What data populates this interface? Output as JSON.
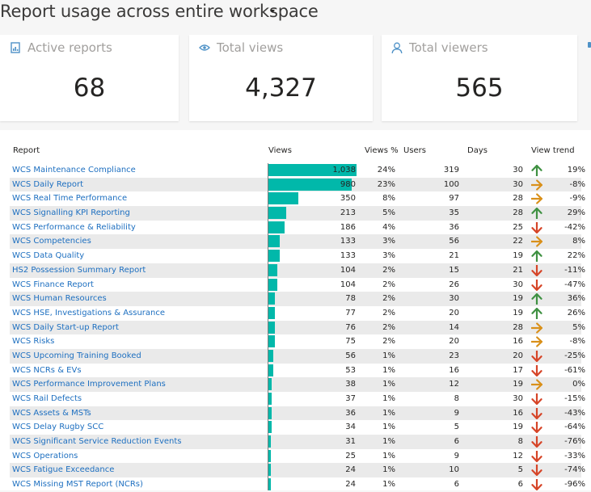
{
  "title": "Report usage across entire workspace",
  "cards": [
    {
      "label": "Active reports",
      "value": "68",
      "icon": "report-icon"
    },
    {
      "label": "Total views",
      "value": "4,327",
      "icon": "eye-icon"
    },
    {
      "label": "Total viewers",
      "value": "565",
      "icon": "person-icon"
    }
  ],
  "table": {
    "columns": {
      "report": "Report",
      "views": "Views",
      "views_pct": "Views %",
      "users": "Users",
      "days": "Days",
      "trend": "View trend"
    },
    "sorted_by": "Views",
    "max_views": 1038,
    "colors": {
      "bar": "#01b8aa",
      "up": "#3f9142",
      "flat": "#d9901a",
      "down": "#d64528",
      "link": "#1d6fc0"
    },
    "rows": [
      {
        "report": "WCS Maintenance Compliance",
        "views": "1,038",
        "views_value": 1038,
        "views_pct": "24%",
        "users": "319",
        "days": "30",
        "trend": "up",
        "trend_pct": "19%"
      },
      {
        "report": "WCS Daily Report",
        "views": "980",
        "views_value": 980,
        "views_pct": "23%",
        "users": "100",
        "days": "30",
        "trend": "flat",
        "trend_pct": "-8%"
      },
      {
        "report": "WCS Real Time Performance",
        "views": "350",
        "views_value": 350,
        "views_pct": "8%",
        "users": "97",
        "days": "28",
        "trend": "flat",
        "trend_pct": "-9%"
      },
      {
        "report": "WCS Signalling KPI Reporting",
        "views": "213",
        "views_value": 213,
        "views_pct": "5%",
        "users": "35",
        "days": "28",
        "trend": "up",
        "trend_pct": "29%"
      },
      {
        "report": "WCS Performance & Reliability",
        "views": "186",
        "views_value": 186,
        "views_pct": "4%",
        "users": "36",
        "days": "25",
        "trend": "down",
        "trend_pct": "-42%"
      },
      {
        "report": "WCS Competencies",
        "views": "133",
        "views_value": 133,
        "views_pct": "3%",
        "users": "56",
        "days": "22",
        "trend": "flat",
        "trend_pct": "8%"
      },
      {
        "report": "WCS Data Quality",
        "views": "133",
        "views_value": 133,
        "views_pct": "3%",
        "users": "21",
        "days": "19",
        "trend": "up",
        "trend_pct": "22%"
      },
      {
        "report": "HS2 Possession Summary Report",
        "views": "104",
        "views_value": 104,
        "views_pct": "2%",
        "users": "15",
        "days": "21",
        "trend": "down",
        "trend_pct": "-11%"
      },
      {
        "report": "WCS Finance Report",
        "views": "104",
        "views_value": 104,
        "views_pct": "2%",
        "users": "26",
        "days": "30",
        "trend": "down",
        "trend_pct": "-47%"
      },
      {
        "report": "WCS Human Resources",
        "views": "78",
        "views_value": 78,
        "views_pct": "2%",
        "users": "30",
        "days": "19",
        "trend": "up",
        "trend_pct": "36%"
      },
      {
        "report": "WCS HSE, Investigations & Assurance",
        "views": "77",
        "views_value": 77,
        "views_pct": "2%",
        "users": "20",
        "days": "19",
        "trend": "up",
        "trend_pct": "26%"
      },
      {
        "report": "WCS Daily Start-up Report",
        "views": "76",
        "views_value": 76,
        "views_pct": "2%",
        "users": "14",
        "days": "28",
        "trend": "flat",
        "trend_pct": "5%"
      },
      {
        "report": "WCS Risks",
        "views": "75",
        "views_value": 75,
        "views_pct": "2%",
        "users": "20",
        "days": "16",
        "trend": "flat",
        "trend_pct": "-8%"
      },
      {
        "report": "WCS Upcoming Training Booked",
        "views": "56",
        "views_value": 56,
        "views_pct": "1%",
        "users": "23",
        "days": "20",
        "trend": "down",
        "trend_pct": "-25%"
      },
      {
        "report": "WCS NCRs & EVs",
        "views": "53",
        "views_value": 53,
        "views_pct": "1%",
        "users": "16",
        "days": "17",
        "trend": "down",
        "trend_pct": "-61%"
      },
      {
        "report": "WCS Performance Improvement Plans",
        "views": "38",
        "views_value": 38,
        "views_pct": "1%",
        "users": "12",
        "days": "19",
        "trend": "flat",
        "trend_pct": "0%"
      },
      {
        "report": "WCS Rail Defects",
        "views": "37",
        "views_value": 37,
        "views_pct": "1%",
        "users": "8",
        "days": "30",
        "trend": "down",
        "trend_pct": "-15%"
      },
      {
        "report": "WCS Assets & MSTs",
        "views": "36",
        "views_value": 36,
        "views_pct": "1%",
        "users": "9",
        "days": "16",
        "trend": "down",
        "trend_pct": "-43%"
      },
      {
        "report": "WCS Delay Rugby SCC",
        "views": "34",
        "views_value": 34,
        "views_pct": "1%",
        "users": "5",
        "days": "19",
        "trend": "down",
        "trend_pct": "-64%"
      },
      {
        "report": "WCS Significant Service Reduction Events",
        "views": "31",
        "views_value": 31,
        "views_pct": "1%",
        "users": "6",
        "days": "8",
        "trend": "down",
        "trend_pct": "-76%"
      },
      {
        "report": "WCS Operations",
        "views": "25",
        "views_value": 25,
        "views_pct": "1%",
        "users": "9",
        "days": "12",
        "trend": "down",
        "trend_pct": "-33%"
      },
      {
        "report": "WCS Fatigue Exceedance",
        "views": "24",
        "views_value": 24,
        "views_pct": "1%",
        "users": "10",
        "days": "5",
        "trend": "down",
        "trend_pct": "-74%"
      },
      {
        "report": "WCS Missing MST Report (NCRs)",
        "views": "24",
        "views_value": 24,
        "views_pct": "1%",
        "users": "6",
        "days": "6",
        "trend": "down",
        "trend_pct": "-96%"
      }
    ]
  }
}
